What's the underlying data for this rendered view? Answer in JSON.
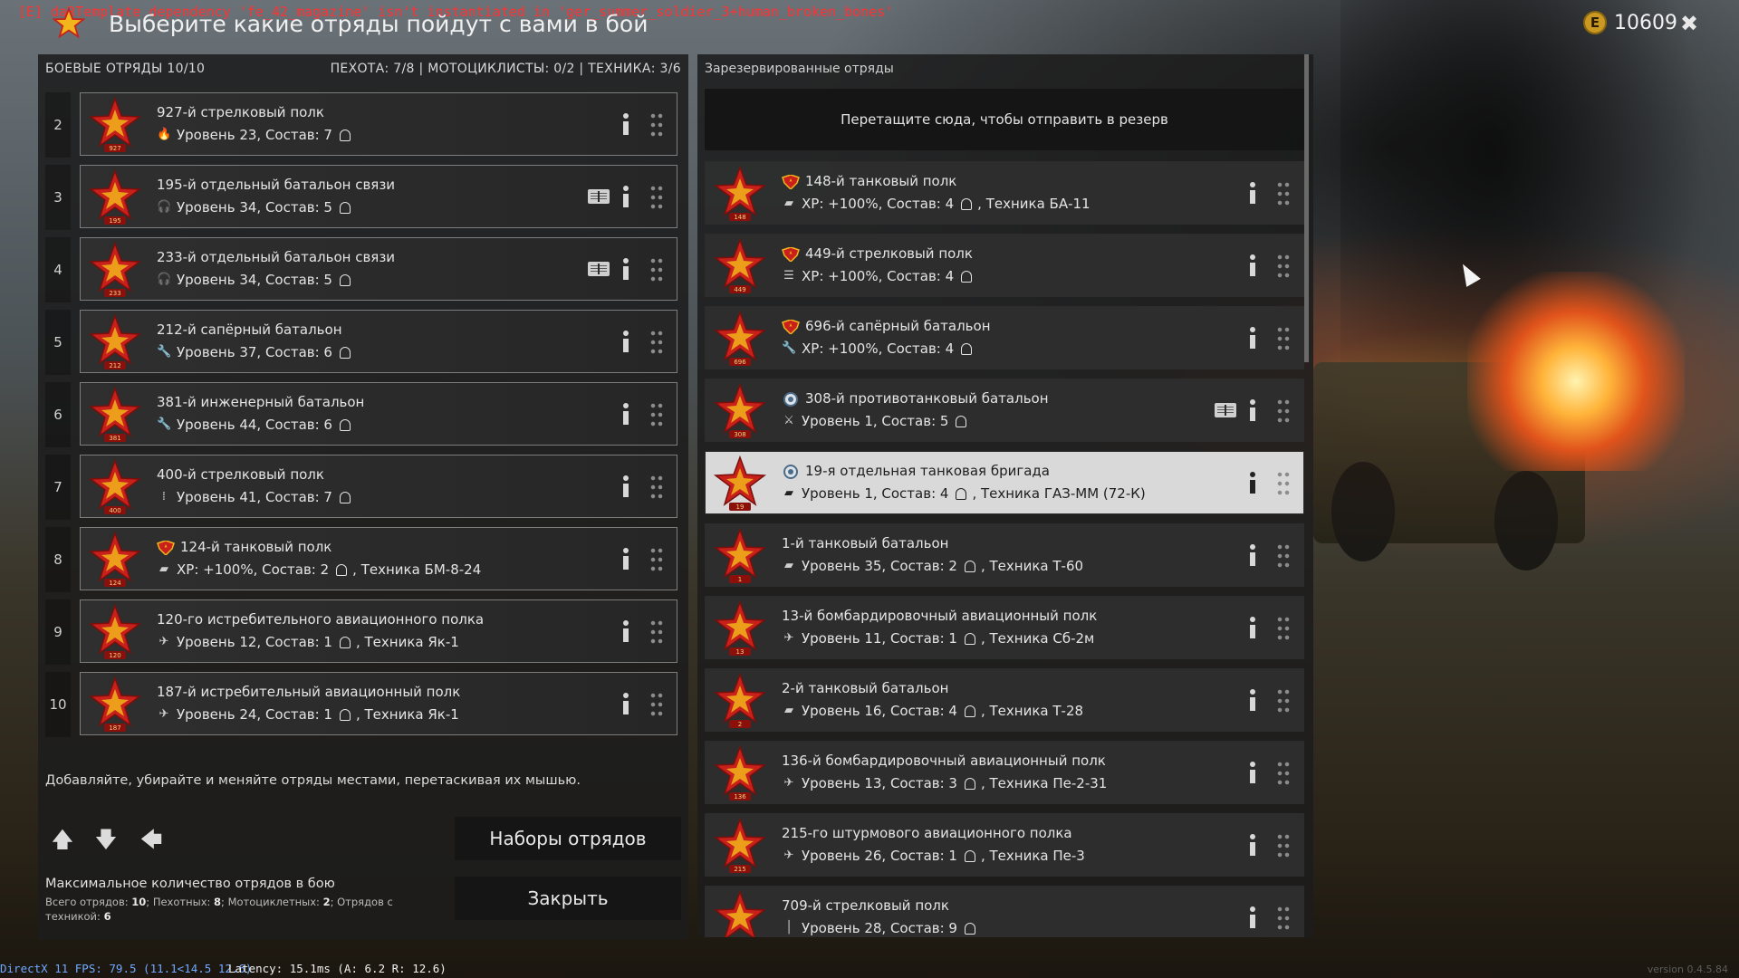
{
  "debug": {
    "error": "[E] daRTemplate dependency 'fe_42_magazine' isn't instantiated in 'ger_summer_soldier_3+human_broken_bones'"
  },
  "header": {
    "title": "Выберите какие отряды пойдут с вами в бой",
    "currency": "10609",
    "coin_letter": "E"
  },
  "left": {
    "title": "БОЕВЫЕ ОТРЯДЫ 10/10",
    "counts": "ПЕХОТА: 7/8 | МОТОЦИКЛИСТЫ: 0/2 | ТЕХНИКА: 3/6",
    "squads": [
      {
        "slot": "2",
        "badge": "927",
        "name": "927-й стрелковый полк",
        "icon": "flame",
        "stats": "Уровень 23, Состав: 7",
        "book": false,
        "medal": false
      },
      {
        "slot": "3",
        "badge": "195",
        "name": "195-й отдельный батальон связи",
        "icon": "headphones",
        "stats": "Уровень 34, Состав: 5",
        "book": true,
        "medal": false
      },
      {
        "slot": "4",
        "badge": "233",
        "name": "233-й отдельный батальон связи",
        "icon": "headphones",
        "stats": "Уровень 34, Состав: 5",
        "book": true,
        "medal": false
      },
      {
        "slot": "5",
        "badge": "212",
        "name": "212-й сапёрный батальон",
        "icon": "wrench",
        "stats": "Уровень 37, Состав: 6",
        "book": false,
        "medal": false
      },
      {
        "slot": "6",
        "badge": "381",
        "name": "381-й инженерный батальон",
        "icon": "wrench",
        "stats": "Уровень 44, Состав: 6",
        "book": false,
        "medal": false
      },
      {
        "slot": "7",
        "badge": "400",
        "name": "400-й стрелковый полк",
        "icon": "ammo",
        "stats": "Уровень 41, Состав: 7",
        "book": false,
        "medal": false
      },
      {
        "slot": "8",
        "badge": "124",
        "name": "124-й танковый полк",
        "icon": "tank",
        "stats": "XP: +100%, Состав: 2",
        "tail": ", Техника БМ-8-24",
        "book": false,
        "medal": true
      },
      {
        "slot": "9",
        "badge": "120",
        "name": "120-го истребительного авиационного полка",
        "icon": "plane",
        "stats": "Уровень 12, Состав: 1",
        "tail": ", Техника Як-1",
        "book": false,
        "medal": false
      },
      {
        "slot": "10",
        "badge": "187",
        "name": "187-й истребительный авиационный полк",
        "icon": "plane",
        "stats": "Уровень 24, Состав: 1",
        "tail": ", Техника Як-1",
        "book": false,
        "medal": false
      }
    ],
    "hint": "Добавляйте, убирайте и меняйте отряды местами, перетаскивая их мышью.",
    "buttons": {
      "sets": "Наборы отрядов",
      "close": "Закрыть"
    },
    "max": {
      "title": "Максимальное количество отрядов в бою",
      "total_label": "Всего отрядов:",
      "total": "10",
      "inf_label": "; Пехотных:",
      "inf": "8",
      "moto_label": "; Мотоциклетных:",
      "moto": "2",
      "veh_label": "; Отрядов с техникой:",
      "veh": "6"
    }
  },
  "right": {
    "title": "Зарезервированные отряды",
    "dropzone": "Перетащите сюда, чтобы отправить в резерв",
    "squads": [
      {
        "badge": "148",
        "name": "148-й танковый полк",
        "icon": "tank",
        "stats": "XP: +100%, Состав: 4",
        "tail": ", Техника БА-11",
        "medal": "red",
        "book": false,
        "highlight": false
      },
      {
        "badge": "449",
        "name": "449-й стрелковый полк",
        "icon": "list",
        "stats": "XP: +100%, Состав: 4",
        "medal": "red",
        "book": false,
        "highlight": false
      },
      {
        "badge": "696",
        "name": "696-й сапёрный батальон",
        "icon": "wrench",
        "stats": "XP: +100%, Состав: 4",
        "medal": "red",
        "book": false,
        "highlight": false
      },
      {
        "badge": "308",
        "name": "308-й противотанковый батальон",
        "icon": "at",
        "stats": "Уровень 1, Состав: 5",
        "medal": "round",
        "book": true,
        "highlight": false
      },
      {
        "badge": "19",
        "name": "19-я отдельная танковая бригада",
        "icon": "tank",
        "stats": "Уровень 1, Состав: 4",
        "tail": ", Техника ГАЗ-ММ (72-К)",
        "medal": "round",
        "book": false,
        "highlight": true
      },
      {
        "badge": "1",
        "name": "1-й танковый батальон",
        "icon": "tank",
        "stats": "Уровень 35, Состав: 2",
        "tail": ", Техника Т-60",
        "medal": "",
        "book": false,
        "highlight": false
      },
      {
        "badge": "13",
        "name": "13-й бомбардировочный авиационный полк",
        "icon": "plane",
        "stats": "Уровень 11, Состав: 1",
        "tail": ", Техника Сб-2м",
        "medal": "",
        "book": false,
        "highlight": false
      },
      {
        "badge": "2",
        "name": "2-й танковый батальон",
        "icon": "tank",
        "stats": "Уровень 16, Состав: 4",
        "tail": ", Техника Т-28",
        "medal": "",
        "book": false,
        "highlight": false
      },
      {
        "badge": "136",
        "name": "136-й бомбардировочный авиационный полк",
        "icon": "plane",
        "stats": "Уровень 13, Состав: 3",
        "tail": ", Техника Пе-2-31",
        "medal": "",
        "book": false,
        "highlight": false
      },
      {
        "badge": "215",
        "name": "215-го штурмового авиационного полка",
        "icon": "plane",
        "stats": "Уровень 26, Состав: 1",
        "tail": ", Техника Пе-3",
        "medal": "",
        "book": false,
        "highlight": false
      },
      {
        "badge": "",
        "name": "709-й стрелковый полк",
        "icon": "rifle",
        "stats": "Уровень 28, Состав: 9",
        "medal": "",
        "book": false,
        "highlight": false
      }
    ]
  },
  "footer": {
    "fps": "DirectX 11 FPS: 79.5 (11.1<14.5 12.6)",
    "latency": "Latency: 15.1ms (A: 6.2 R: 12.6)",
    "version": "version 0.4.5.84"
  },
  "colors": {
    "star": "#c8201a",
    "star_yellow": "#f2b51c",
    "accent": "#c99922"
  },
  "icons": {
    "flame": "🔥",
    "headphones": "🎧",
    "wrench": "🔧",
    "ammo": "⁞",
    "tank": "▰",
    "plane": "✈",
    "list": "☰",
    "at": "⚔",
    "rifle": "│"
  }
}
